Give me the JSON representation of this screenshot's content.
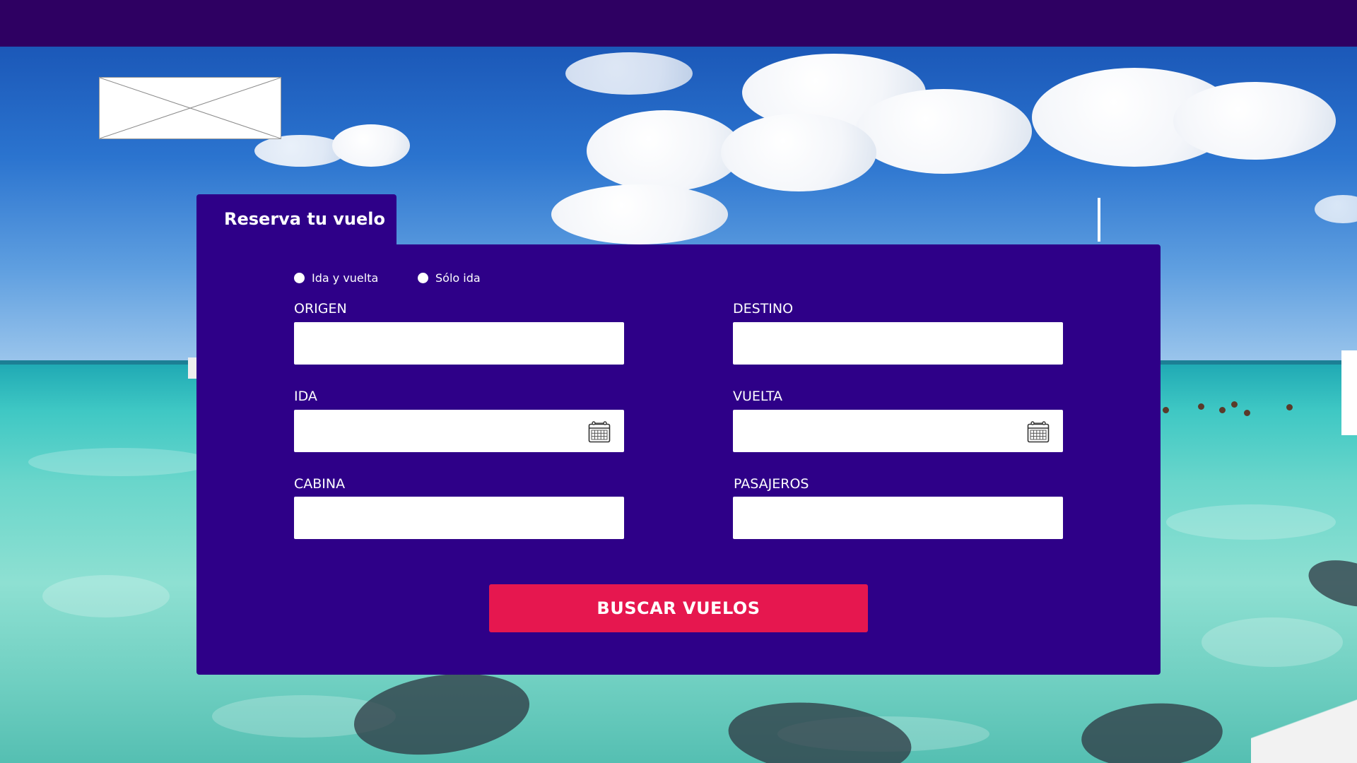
{
  "booking": {
    "title": "Reserva tu vuelo",
    "trip_type_options": [
      {
        "label": "Ida y vuelta"
      },
      {
        "label": "Sólo ida"
      }
    ],
    "fields": {
      "origin": {
        "label": "ORIGEN",
        "value": ""
      },
      "destination": {
        "label": "DESTINO",
        "value": ""
      },
      "departure": {
        "label": "IDA",
        "value": "",
        "icon": "calendar-icon"
      },
      "return": {
        "label": "VUELTA",
        "value": "",
        "icon": "calendar-icon"
      },
      "cabin": {
        "label": "CABINA",
        "value": ""
      },
      "passengers": {
        "label": "PASAJEROS",
        "value": ""
      }
    },
    "submit_label": "BUSCAR VUELOS"
  },
  "colors": {
    "top_bar": "#2e0062",
    "panel": "#2e0088",
    "submit": "#e6174f",
    "text": "#ffffff"
  }
}
